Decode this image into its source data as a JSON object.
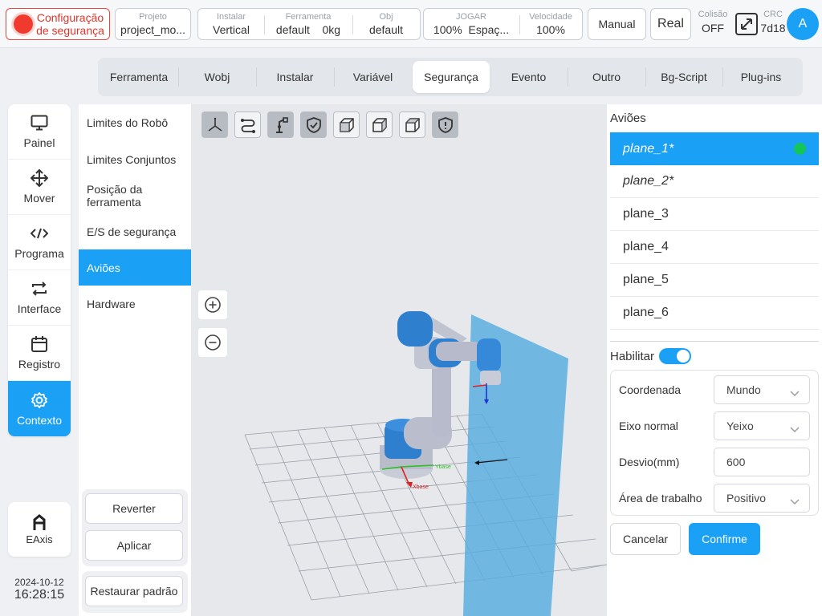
{
  "topbar": {
    "safety_line1": "Configuração",
    "safety_line2": "de segurança",
    "project": {
      "label": "Projeto",
      "value": "project_mo..."
    },
    "install": {
      "label": "Instalar",
      "value": "Vertical"
    },
    "tool": {
      "label": "Ferramenta",
      "value": "default",
      "mass": "0kg"
    },
    "obj": {
      "label": "Obj",
      "value": "default"
    },
    "jog": {
      "label": "JOGAR",
      "percent": "100%",
      "space": "Espaç..."
    },
    "speed": {
      "label": "Velocidade",
      "value": "100%"
    },
    "manual": "Manual",
    "real": "Real",
    "collision": {
      "label": "Colisão",
      "value": "OFF"
    },
    "crc": {
      "label": "CRC",
      "value": "7d18"
    },
    "avatar": "A"
  },
  "tabs": [
    {
      "label": "Ferramenta",
      "active": false
    },
    {
      "label": "Wobj",
      "active": false
    },
    {
      "label": "Instalar",
      "active": false
    },
    {
      "label": "Variável",
      "active": false
    },
    {
      "label": "Segurança",
      "active": true
    },
    {
      "label": "Evento",
      "active": false
    },
    {
      "label": "Outro",
      "active": false
    },
    {
      "label": "Bg-Script",
      "active": false
    },
    {
      "label": "Plug-ins",
      "active": false
    }
  ],
  "leftnav": {
    "items": [
      {
        "label": "Painel",
        "icon": "monitor-icon"
      },
      {
        "label": "Mover",
        "icon": "move-icon"
      },
      {
        "label": "Programa",
        "icon": "code-icon"
      },
      {
        "label": "Interface",
        "icon": "swap-icon"
      },
      {
        "label": "Registro",
        "icon": "calendar-icon"
      },
      {
        "label": "Contexto",
        "icon": "gear-icon",
        "active": true
      }
    ],
    "eaxis": "EAxis",
    "date": "2024-10-12",
    "time": "16:28:15"
  },
  "submenu": {
    "items": [
      {
        "label": "Limites do Robô"
      },
      {
        "label": "Limites Conjuntos"
      },
      {
        "label": "Posição da ferramenta"
      },
      {
        "label": "E/S de segurança"
      },
      {
        "label": "Aviões",
        "active": true
      },
      {
        "label": "Hardware"
      }
    ],
    "revert": "Reverter",
    "apply": "Aplicar",
    "restore": "Restaurar padrão"
  },
  "view3d": {
    "tools": [
      "axes-icon",
      "path-icon",
      "robot-icon",
      "shield-check-icon",
      "cube-front-icon",
      "cube-side-icon",
      "cube-top-icon",
      "shield-alert-icon"
    ],
    "base_x_label": "Xbase",
    "base_y_label": "Ybase"
  },
  "planes": {
    "title": "Aviões",
    "items": [
      {
        "label": "plane_1*",
        "active": true,
        "italic": true
      },
      {
        "label": "plane_2*",
        "active": false,
        "italic": true
      },
      {
        "label": "plane_3",
        "active": false
      },
      {
        "label": "plane_4",
        "active": false
      },
      {
        "label": "plane_5",
        "active": false
      },
      {
        "label": "plane_6",
        "active": false
      }
    ],
    "enable_label": "Habilitar",
    "enabled": true,
    "form": {
      "coord_label": "Coordenada",
      "coord_value": "Mundo",
      "axis_label": "Eixo normal",
      "axis_value": "Yeixo",
      "offset_label": "Desvio(mm)",
      "offset_value": "600",
      "area_label": "Área de trabalho",
      "area_value": "Positivo"
    },
    "cancel": "Cancelar",
    "confirm": "Confirme"
  },
  "colors": {
    "accent": "#1aa0f5",
    "danger": "#f03a2e",
    "active_dot": "#14c55a",
    "plane_fill": "#5aaee0"
  }
}
